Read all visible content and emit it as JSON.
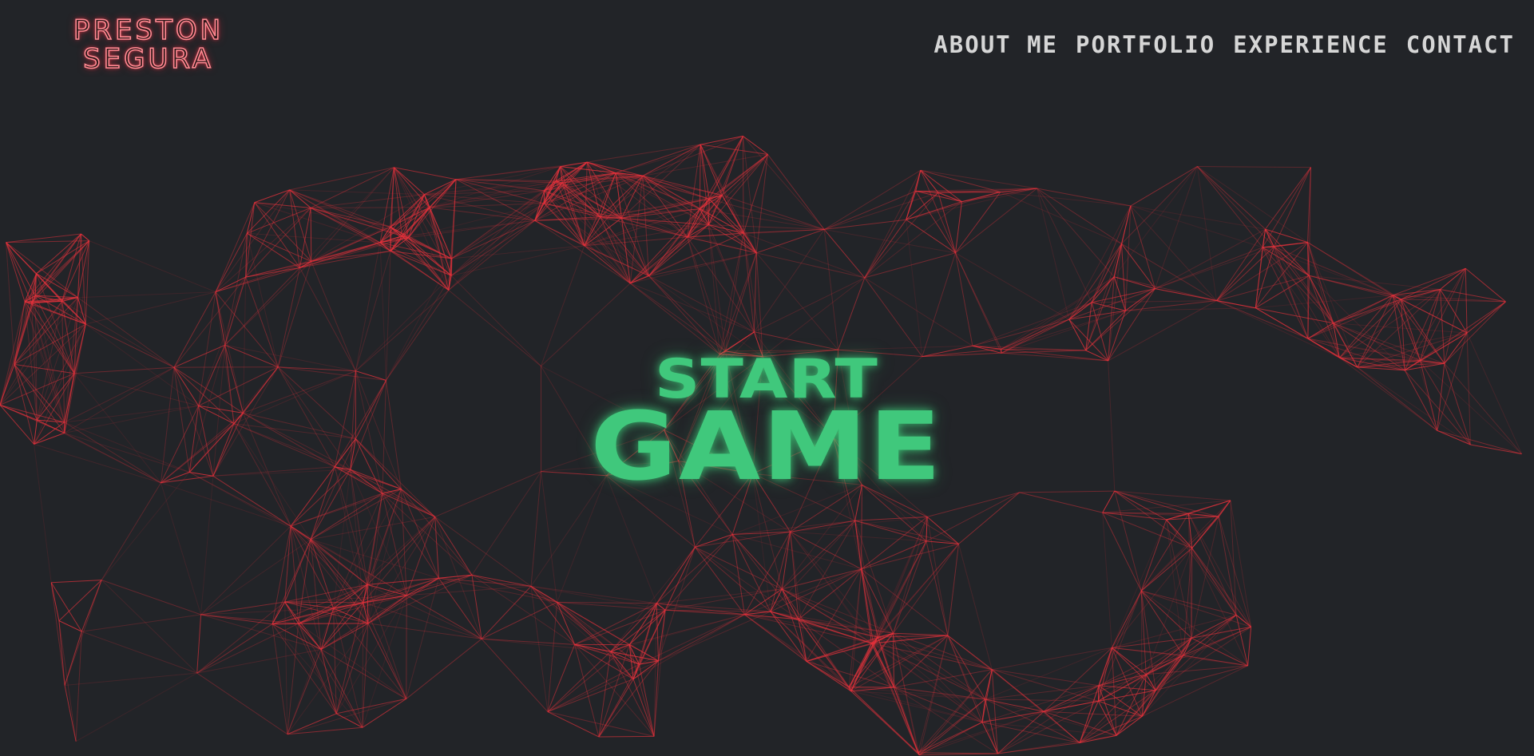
{
  "logo": {
    "line1": "PRESTON",
    "line2": "SEGURA"
  },
  "nav": {
    "items": [
      {
        "label": "ABOUT ME"
      },
      {
        "label": "PORTFOLIO"
      },
      {
        "label": "EXPERIENCE"
      },
      {
        "label": "CONTACT"
      }
    ]
  },
  "hero": {
    "line1": "START",
    "line2": "GAME"
  },
  "colors": {
    "background": "#222428",
    "logo_neon": "#ff8a92",
    "nav_text": "#d6d6d6",
    "start_green": "#40c87c",
    "network_line": "#e8323c"
  }
}
